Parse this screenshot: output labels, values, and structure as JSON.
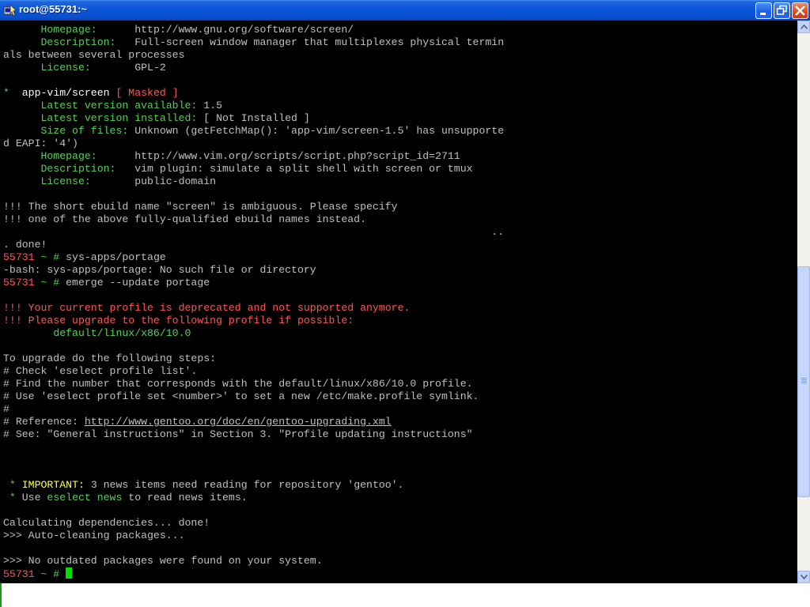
{
  "window": {
    "title": "root@55731:~"
  },
  "terminal": {
    "lines": [
      [
        {
          "t": "      "
        },
        {
          "t": "Homepage:",
          "c": "green"
        },
        {
          "t": "      http://www.gnu.org/software/screen/"
        }
      ],
      [
        {
          "t": "      "
        },
        {
          "t": "Description:",
          "c": "green"
        },
        {
          "t": "   Full-screen window manager that multiplexes physical termin"
        }
      ],
      [
        {
          "t": "als between several processes"
        }
      ],
      [
        {
          "t": "      "
        },
        {
          "t": "License:",
          "c": "green"
        },
        {
          "t": "       GPL-2"
        }
      ],
      [],
      [
        {
          "t": "*",
          "c": "green"
        },
        {
          "t": "  "
        },
        {
          "t": "app-vim/screen",
          "c": "bright"
        },
        {
          "t": " [ Masked ]",
          "c": "red"
        }
      ],
      [
        {
          "t": "      "
        },
        {
          "t": "Latest version available:",
          "c": "green"
        },
        {
          "t": " 1.5"
        }
      ],
      [
        {
          "t": "      "
        },
        {
          "t": "Latest version installed:",
          "c": "green"
        },
        {
          "t": " [ Not Installed ]"
        }
      ],
      [
        {
          "t": "      "
        },
        {
          "t": "Size of files:",
          "c": "green"
        },
        {
          "t": " Unknown (getFetchMap(): 'app-vim/screen-1.5' has unsupporte"
        }
      ],
      [
        {
          "t": "d EAPI: '4')"
        }
      ],
      [
        {
          "t": "      "
        },
        {
          "t": "Homepage:",
          "c": "green"
        },
        {
          "t": "      http://www.vim.org/scripts/script.php?script_id=2711"
        }
      ],
      [
        {
          "t": "      "
        },
        {
          "t": "Description:",
          "c": "green"
        },
        {
          "t": "   vim plugin: simulate a split shell with screen or tmux"
        }
      ],
      [
        {
          "t": "      "
        },
        {
          "t": "License:",
          "c": "green"
        },
        {
          "t": "       public-domain"
        }
      ],
      [],
      [
        {
          "t": "!!! The short ebuild name \"screen\" is ambiguous. Please specify"
        }
      ],
      [
        {
          "t": "!!! one of the above fully-qualified ebuild names instead."
        }
      ],
      [
        {
          "t": "                                                                              .."
        }
      ],
      [
        {
          "t": ". done!"
        }
      ],
      [
        {
          "t": "55731 ",
          "c": "red"
        },
        {
          "t": "~ #",
          "c": "green"
        },
        {
          "t": " sys-apps/portage"
        }
      ],
      [
        {
          "t": "-bash: sys-apps/portage: No such file or directory"
        }
      ],
      [
        {
          "t": "55731 ",
          "c": "red"
        },
        {
          "t": "~ #",
          "c": "green"
        },
        {
          "t": " emerge --update portage"
        }
      ],
      [],
      [
        {
          "t": "!!! Your current profile is deprecated and not supported anymore.",
          "c": "red"
        }
      ],
      [
        {
          "t": "!!! Please upgrade to the following profile if possible:",
          "c": "red"
        }
      ],
      [
        {
          "t": "        "
        },
        {
          "t": "default/linux/x86/10.0",
          "c": "green"
        }
      ],
      [],
      [
        {
          "t": "To upgrade do the following steps:"
        }
      ],
      [
        {
          "t": "# Check 'eselect profile list'."
        }
      ],
      [
        {
          "t": "# Find the number that corresponds with the default/linux/x86/10.0 profile."
        }
      ],
      [
        {
          "t": "# Use 'eselect profile set <number>' to set a new /etc/make.profile symlink."
        }
      ],
      [
        {
          "t": "#"
        }
      ],
      [
        {
          "t": "# Reference: "
        },
        {
          "t": "http://www.gentoo.org/doc/en/gentoo-upgrading.xml",
          "u": true
        }
      ],
      [
        {
          "t": "# See: \"General instructions\" in Section 3. \"Profile updating instructions\""
        }
      ],
      [],
      [],
      [],
      [
        {
          "t": " "
        },
        {
          "t": "*",
          "c": "green"
        },
        {
          "t": " "
        },
        {
          "t": "IMPORTANT:",
          "c": "yellow"
        },
        {
          "t": " 3 news items need reading for repository 'gentoo'."
        }
      ],
      [
        {
          "t": " "
        },
        {
          "t": "*",
          "c": "green"
        },
        {
          "t": " Use "
        },
        {
          "t": "eselect news",
          "c": "green"
        },
        {
          "t": " to read news items."
        }
      ],
      [],
      [
        {
          "t": "Calculating dependencies... done!"
        }
      ],
      [
        {
          "t": ">>> Auto-cleaning packages..."
        }
      ],
      [],
      [
        {
          "t": ">>> No outdated packages were found on your system."
        }
      ],
      [
        {
          "t": "55731 ",
          "c": "red"
        },
        {
          "t": "~ #",
          "c": "green"
        },
        {
          "t": " "
        },
        {
          "cursor": true
        }
      ]
    ]
  },
  "scrollbar": {
    "position_fraction": 0.76
  },
  "icons": {
    "app": "putty-icon",
    "minimize": "minimize-icon",
    "maximize": "restore-icon",
    "close": "close-icon"
  }
}
